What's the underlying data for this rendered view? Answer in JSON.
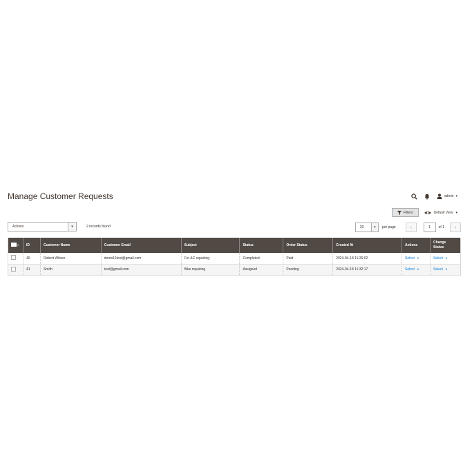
{
  "page": {
    "title": "Manage Customer Requests"
  },
  "header": {
    "admin_user": "admin"
  },
  "toolbar": {
    "filters_label": "Filters",
    "default_view_label": "Default View"
  },
  "mass_actions": {
    "selected": "Actions"
  },
  "records": {
    "found_text": "2 records found"
  },
  "pager": {
    "per_page_value": "20",
    "per_page_label": "per page",
    "current_page": "1",
    "of_text": "of 1"
  },
  "grid": {
    "columns": [
      "ID",
      "Customer Name",
      "Customer Email",
      "Subject",
      "Status",
      "Order Status",
      "Created At",
      "Actions",
      "Change Status"
    ],
    "rows": [
      {
        "id": "40",
        "name": "Robert Wilson",
        "email": "demo11test@gmail.com",
        "subject": "For AC repairing",
        "status": "Completed",
        "order_status": "Paid",
        "created_at": "2024-04-18 11:26:02",
        "action": "Select",
        "change_status": "Select"
      },
      {
        "id": "41",
        "name": "Smith",
        "email": "test@gmail.com",
        "subject": "Bike repairing",
        "status": "Assigned",
        "order_status": "Pending",
        "created_at": "2024-04-18 11:32:17",
        "action": "Select",
        "change_status": "Select"
      }
    ]
  },
  "icons": {
    "search": "search-icon",
    "bell": "bell-icon",
    "user": "user-icon",
    "filter": "filter-icon",
    "eye": "eye-icon"
  },
  "colors": {
    "header_bg": "#514943",
    "link": "#007bdb",
    "title": "#41362f"
  }
}
